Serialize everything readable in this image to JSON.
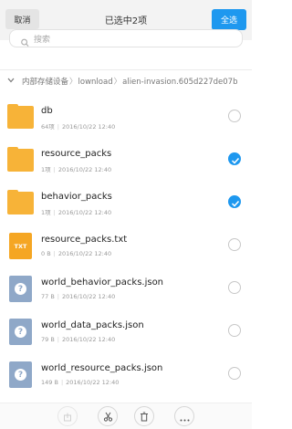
{
  "header": {
    "cancel_label": "取消",
    "title": "已选中2项",
    "select_all_label": "全选"
  },
  "search": {
    "placeholder": "搜索"
  },
  "breadcrumb": {
    "items": [
      "内部存储设备",
      "lownload",
      "alien-invasion.605d227de07b"
    ]
  },
  "files": [
    {
      "name": "db",
      "count": "64项",
      "date": "2016/10/22 12:40",
      "icon": "folder-icon",
      "selected": false
    },
    {
      "name": "resource_packs",
      "count": "1项",
      "date": "2016/10/22 12:40",
      "icon": "folder-icon",
      "selected": true
    },
    {
      "name": "behavior_packs",
      "count": "1项",
      "date": "2016/10/22 12:40",
      "icon": "folder-icon",
      "selected": true
    },
    {
      "name": "resource_packs.txt",
      "count": "0 B",
      "date": "2016/10/22 12:40",
      "icon": "txt-file-icon",
      "icon_label": "TXT",
      "selected": false
    },
    {
      "name": "world_behavior_packs.json",
      "count": "77 B",
      "date": "2016/10/22 12:40",
      "icon": "unknown-file-icon",
      "selected": false
    },
    {
      "name": "world_data_packs.json",
      "count": "79 B",
      "date": "2016/10/22 12:40",
      "icon": "unknown-file-icon",
      "selected": false
    },
    {
      "name": "world_resource_packs.json",
      "count": "149 B",
      "date": "2016/10/22 12:40",
      "icon": "unknown-file-icon",
      "selected": false
    }
  ],
  "toolbar": {
    "tools": [
      "share-icon",
      "cut-icon",
      "delete-icon",
      "more-icon"
    ]
  },
  "colors": {
    "accent": "#1e98ef",
    "folder": "#f7b338",
    "txt": "#f5a623",
    "unknown": "#8fa8c8"
  }
}
